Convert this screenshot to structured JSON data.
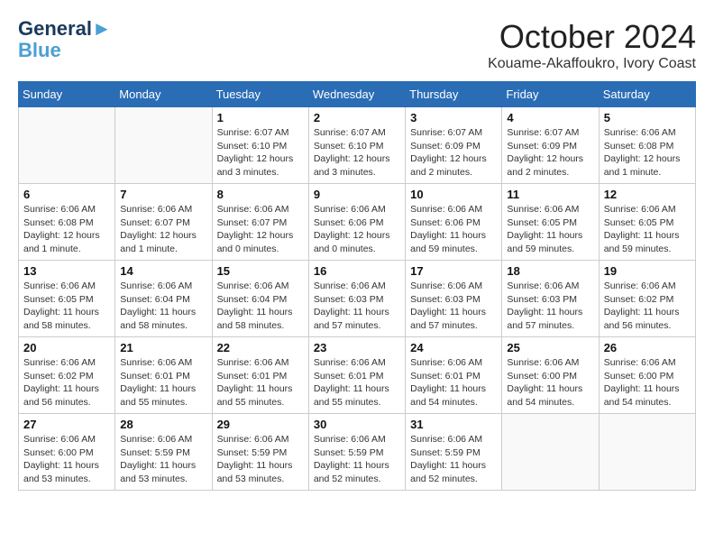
{
  "logo": {
    "line1": "General",
    "line2": "Blue"
  },
  "title": "October 2024",
  "location": "Kouame-Akaffoukro, Ivory Coast",
  "days_of_week": [
    "Sunday",
    "Monday",
    "Tuesday",
    "Wednesday",
    "Thursday",
    "Friday",
    "Saturday"
  ],
  "weeks": [
    [
      {
        "day": "",
        "info": ""
      },
      {
        "day": "",
        "info": ""
      },
      {
        "day": "1",
        "info": "Sunrise: 6:07 AM\nSunset: 6:10 PM\nDaylight: 12 hours and 3 minutes."
      },
      {
        "day": "2",
        "info": "Sunrise: 6:07 AM\nSunset: 6:10 PM\nDaylight: 12 hours and 3 minutes."
      },
      {
        "day": "3",
        "info": "Sunrise: 6:07 AM\nSunset: 6:09 PM\nDaylight: 12 hours and 2 minutes."
      },
      {
        "day": "4",
        "info": "Sunrise: 6:07 AM\nSunset: 6:09 PM\nDaylight: 12 hours and 2 minutes."
      },
      {
        "day": "5",
        "info": "Sunrise: 6:06 AM\nSunset: 6:08 PM\nDaylight: 12 hours and 1 minute."
      }
    ],
    [
      {
        "day": "6",
        "info": "Sunrise: 6:06 AM\nSunset: 6:08 PM\nDaylight: 12 hours and 1 minute."
      },
      {
        "day": "7",
        "info": "Sunrise: 6:06 AM\nSunset: 6:07 PM\nDaylight: 12 hours and 1 minute."
      },
      {
        "day": "8",
        "info": "Sunrise: 6:06 AM\nSunset: 6:07 PM\nDaylight: 12 hours and 0 minutes."
      },
      {
        "day": "9",
        "info": "Sunrise: 6:06 AM\nSunset: 6:06 PM\nDaylight: 12 hours and 0 minutes."
      },
      {
        "day": "10",
        "info": "Sunrise: 6:06 AM\nSunset: 6:06 PM\nDaylight: 11 hours and 59 minutes."
      },
      {
        "day": "11",
        "info": "Sunrise: 6:06 AM\nSunset: 6:05 PM\nDaylight: 11 hours and 59 minutes."
      },
      {
        "day": "12",
        "info": "Sunrise: 6:06 AM\nSunset: 6:05 PM\nDaylight: 11 hours and 59 minutes."
      }
    ],
    [
      {
        "day": "13",
        "info": "Sunrise: 6:06 AM\nSunset: 6:05 PM\nDaylight: 11 hours and 58 minutes."
      },
      {
        "day": "14",
        "info": "Sunrise: 6:06 AM\nSunset: 6:04 PM\nDaylight: 11 hours and 58 minutes."
      },
      {
        "day": "15",
        "info": "Sunrise: 6:06 AM\nSunset: 6:04 PM\nDaylight: 11 hours and 58 minutes."
      },
      {
        "day": "16",
        "info": "Sunrise: 6:06 AM\nSunset: 6:03 PM\nDaylight: 11 hours and 57 minutes."
      },
      {
        "day": "17",
        "info": "Sunrise: 6:06 AM\nSunset: 6:03 PM\nDaylight: 11 hours and 57 minutes."
      },
      {
        "day": "18",
        "info": "Sunrise: 6:06 AM\nSunset: 6:03 PM\nDaylight: 11 hours and 57 minutes."
      },
      {
        "day": "19",
        "info": "Sunrise: 6:06 AM\nSunset: 6:02 PM\nDaylight: 11 hours and 56 minutes."
      }
    ],
    [
      {
        "day": "20",
        "info": "Sunrise: 6:06 AM\nSunset: 6:02 PM\nDaylight: 11 hours and 56 minutes."
      },
      {
        "day": "21",
        "info": "Sunrise: 6:06 AM\nSunset: 6:01 PM\nDaylight: 11 hours and 55 minutes."
      },
      {
        "day": "22",
        "info": "Sunrise: 6:06 AM\nSunset: 6:01 PM\nDaylight: 11 hours and 55 minutes."
      },
      {
        "day": "23",
        "info": "Sunrise: 6:06 AM\nSunset: 6:01 PM\nDaylight: 11 hours and 55 minutes."
      },
      {
        "day": "24",
        "info": "Sunrise: 6:06 AM\nSunset: 6:01 PM\nDaylight: 11 hours and 54 minutes."
      },
      {
        "day": "25",
        "info": "Sunrise: 6:06 AM\nSunset: 6:00 PM\nDaylight: 11 hours and 54 minutes."
      },
      {
        "day": "26",
        "info": "Sunrise: 6:06 AM\nSunset: 6:00 PM\nDaylight: 11 hours and 54 minutes."
      }
    ],
    [
      {
        "day": "27",
        "info": "Sunrise: 6:06 AM\nSunset: 6:00 PM\nDaylight: 11 hours and 53 minutes."
      },
      {
        "day": "28",
        "info": "Sunrise: 6:06 AM\nSunset: 5:59 PM\nDaylight: 11 hours and 53 minutes."
      },
      {
        "day": "29",
        "info": "Sunrise: 6:06 AM\nSunset: 5:59 PM\nDaylight: 11 hours and 53 minutes."
      },
      {
        "day": "30",
        "info": "Sunrise: 6:06 AM\nSunset: 5:59 PM\nDaylight: 11 hours and 52 minutes."
      },
      {
        "day": "31",
        "info": "Sunrise: 6:06 AM\nSunset: 5:59 PM\nDaylight: 11 hours and 52 minutes."
      },
      {
        "day": "",
        "info": ""
      },
      {
        "day": "",
        "info": ""
      }
    ]
  ]
}
